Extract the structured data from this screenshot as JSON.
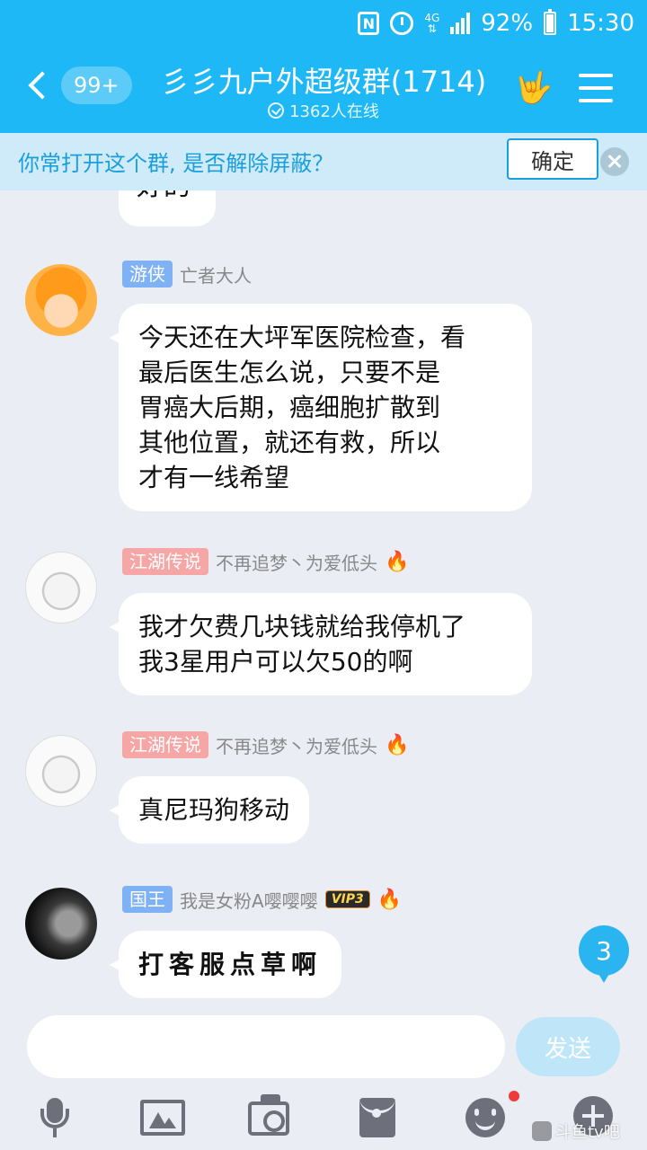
{
  "status_bar": {
    "network": "4G",
    "battery_percent": "92%",
    "time": "15:30"
  },
  "header": {
    "back_badge": "99+",
    "title": "彡彡九户外超级群(1714)",
    "online_text": "1362人在线"
  },
  "notice": {
    "text": "你常打开这个群, 是否解除屏蔽？",
    "confirm_label": "确定"
  },
  "partial_message": "好的",
  "messages": [
    {
      "tag": "游侠",
      "tag_color": "#7fb2f5",
      "sender": "亡者大人",
      "avatar": "cartoon-avatar",
      "lines": [
        "今天还在大坪军医院检查，看",
        "最后医生怎么说，只要不是",
        "胃癌大后期，癌细胞扩散到",
        "其他位置，就还有救，所以",
        "才有一线希望"
      ]
    },
    {
      "tag": "江湖传说",
      "tag_color": "#f7a6a6",
      "sender": "不再追梦丶为爱低头",
      "avatar": "anime-cat-avatar",
      "badges": [
        "fire"
      ],
      "lines": [
        "我才欠费几块钱就给我停机了",
        "我3星用户可以欠50的啊"
      ]
    },
    {
      "tag": "江湖传说",
      "tag_color": "#f7a6a6",
      "sender": "不再追梦丶为爱低头",
      "avatar": "anime-cat-avatar",
      "badges": [
        "fire"
      ],
      "lines": [
        "真尼玛狗移动"
      ]
    },
    {
      "tag": "国王",
      "tag_color": "#7fb2f5",
      "sender": "我是女粉A嘤嘤嘤",
      "avatar": "photo-avatar",
      "badges": [
        "vip",
        "fire"
      ],
      "vip_label": "VIP3",
      "lines": [
        "打客服点草啊"
      ]
    }
  ],
  "new_message_count": "3",
  "composer": {
    "input_value": "",
    "send_label": "发送"
  },
  "toolbar": {
    "icons": [
      "microphone-icon",
      "image-icon",
      "camera-icon",
      "red-packet-icon",
      "emoji-icon",
      "plus-icon"
    ]
  },
  "watermark": "斗鱼tv吧"
}
